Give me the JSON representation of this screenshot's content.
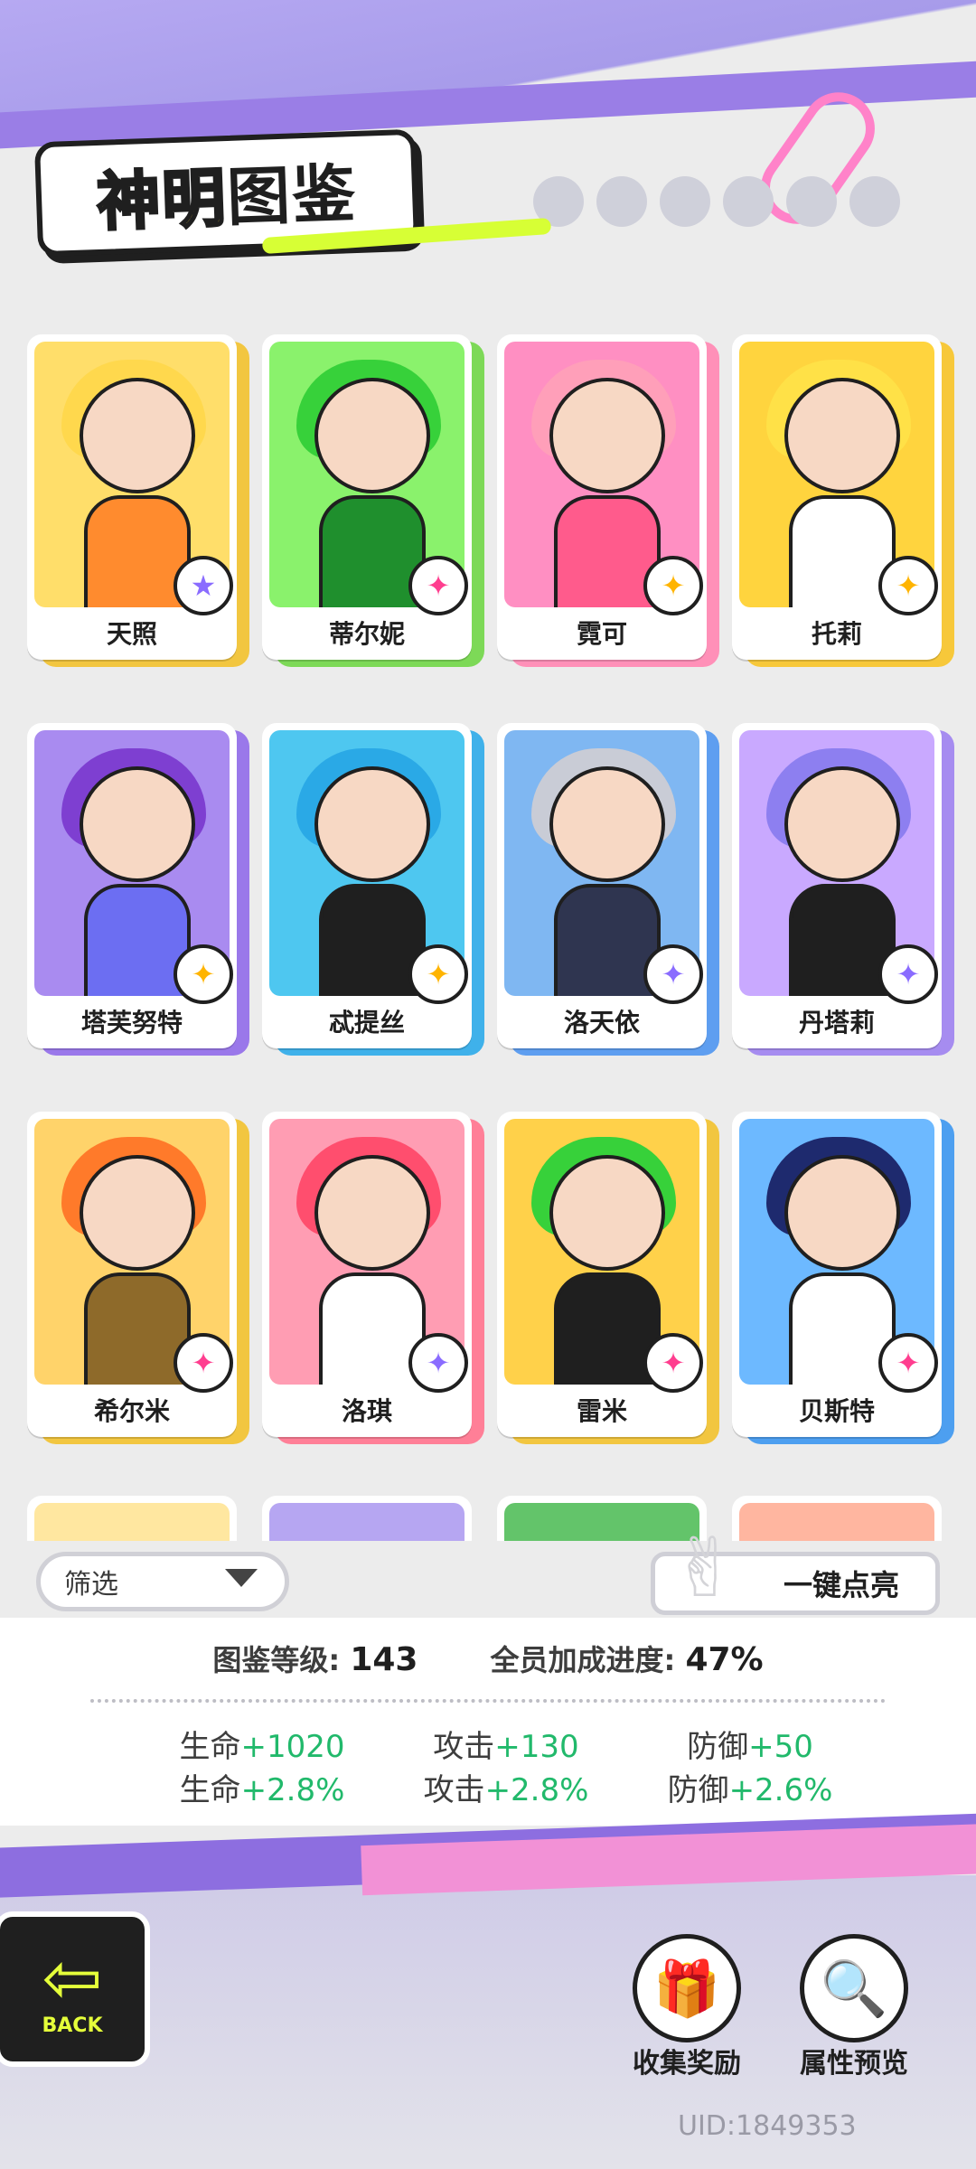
{
  "header": {
    "title_part1": "神明",
    "title_part2": "图鉴"
  },
  "cards": [
    {
      "name": "天照",
      "hair": "#ffd84d",
      "body": "#ff8b2e",
      "bg": "#ffde6a",
      "back": "#f2c640",
      "badge": "★",
      "badge_color": "#8a6cff"
    },
    {
      "name": "蒂尔妮",
      "hair": "#37d13a",
      "body": "#1f8f2d",
      "bg": "#8af26c",
      "back": "#7dd957",
      "badge": "✦",
      "badge_color": "#ff3e8f"
    },
    {
      "name": "霓可",
      "hair": "#ff9fb9",
      "body": "#ff5b8c",
      "bg": "#ff8fc2",
      "back": "#ff90b8",
      "badge": "✦",
      "badge_color": "#ffb400"
    },
    {
      "name": "托莉",
      "hair": "#ffe147",
      "body": "#ffffff",
      "bg": "#ffd43e",
      "back": "#f7c83a",
      "badge": "✦",
      "badge_color": "#ffb400"
    },
    {
      "name": "塔芙努特",
      "hair": "#7e3fd1",
      "body": "#6c6ef2",
      "bg": "#a98bf0",
      "back": "#9a78ea",
      "badge": "✦",
      "badge_color": "#ffb400"
    },
    {
      "name": "忒提丝",
      "hair": "#2aa9e6",
      "body": "#1f1f1f",
      "bg": "#4ec7f0",
      "back": "#3fb1ea",
      "badge": "✦",
      "badge_color": "#ffb400"
    },
    {
      "name": "洛天依",
      "hair": "#c9ccd6",
      "body": "#2f3550",
      "bg": "#7fb7f2",
      "back": "#5e9ef0",
      "badge": "✦",
      "badge_color": "#8a6cff"
    },
    {
      "name": "丹塔莉",
      "hair": "#8d7ff0",
      "body": "#1f1f1f",
      "bg": "#c9a9ff",
      "back": "#a68cf0",
      "badge": "✦",
      "badge_color": "#8a6cff"
    },
    {
      "name": "希尔米",
      "hair": "#ff7a2a",
      "body": "#8e6a2a",
      "bg": "#ffd36a",
      "back": "#f2c640",
      "badge": "✦",
      "badge_color": "#ff3e8f"
    },
    {
      "name": "洛琪",
      "hair": "#ff4e6e",
      "body": "#ffffff",
      "bg": "#ff9db3",
      "back": "#ff7f97",
      "badge": "✦",
      "badge_color": "#8a6cff"
    },
    {
      "name": "雷米",
      "hair": "#37d13a",
      "body": "#1f1f1f",
      "bg": "#ffd14a",
      "back": "#f2c640",
      "badge": "✦",
      "badge_color": "#ff3e8f"
    },
    {
      "name": "贝斯特",
      "hair": "#1e2a6e",
      "body": "#ffffff",
      "bg": "#6db9ff",
      "back": "#4d9ff0",
      "badge": "✦",
      "badge_color": "#ff3e8f"
    }
  ],
  "partial_cards": [
    {
      "bg": "#ffe7a0"
    },
    {
      "bg": "#b6a6f2"
    },
    {
      "bg": "#63c46a"
    },
    {
      "bg": "#ffb6a0"
    }
  ],
  "filter": {
    "label": "筛选"
  },
  "oneclick": {
    "label": "一键点亮"
  },
  "stats": {
    "level_label": "图鉴等级:",
    "level_value": "143",
    "progress_label": "全员加成进度:",
    "progress_value": "47%",
    "bonuses": [
      {
        "label": "生命",
        "value": "+1020"
      },
      {
        "label": "攻击",
        "value": "+130"
      },
      {
        "label": "防御",
        "value": "+50"
      },
      {
        "label": "生命",
        "value": "+2.8%"
      },
      {
        "label": "攻击",
        "value": "+2.8%"
      },
      {
        "label": "防御",
        "value": "+2.6%"
      }
    ]
  },
  "bottom": {
    "back_label": "BACK",
    "collect_label": "收集奖励",
    "preview_label": "属性预览",
    "uid": "UID:1849353"
  }
}
